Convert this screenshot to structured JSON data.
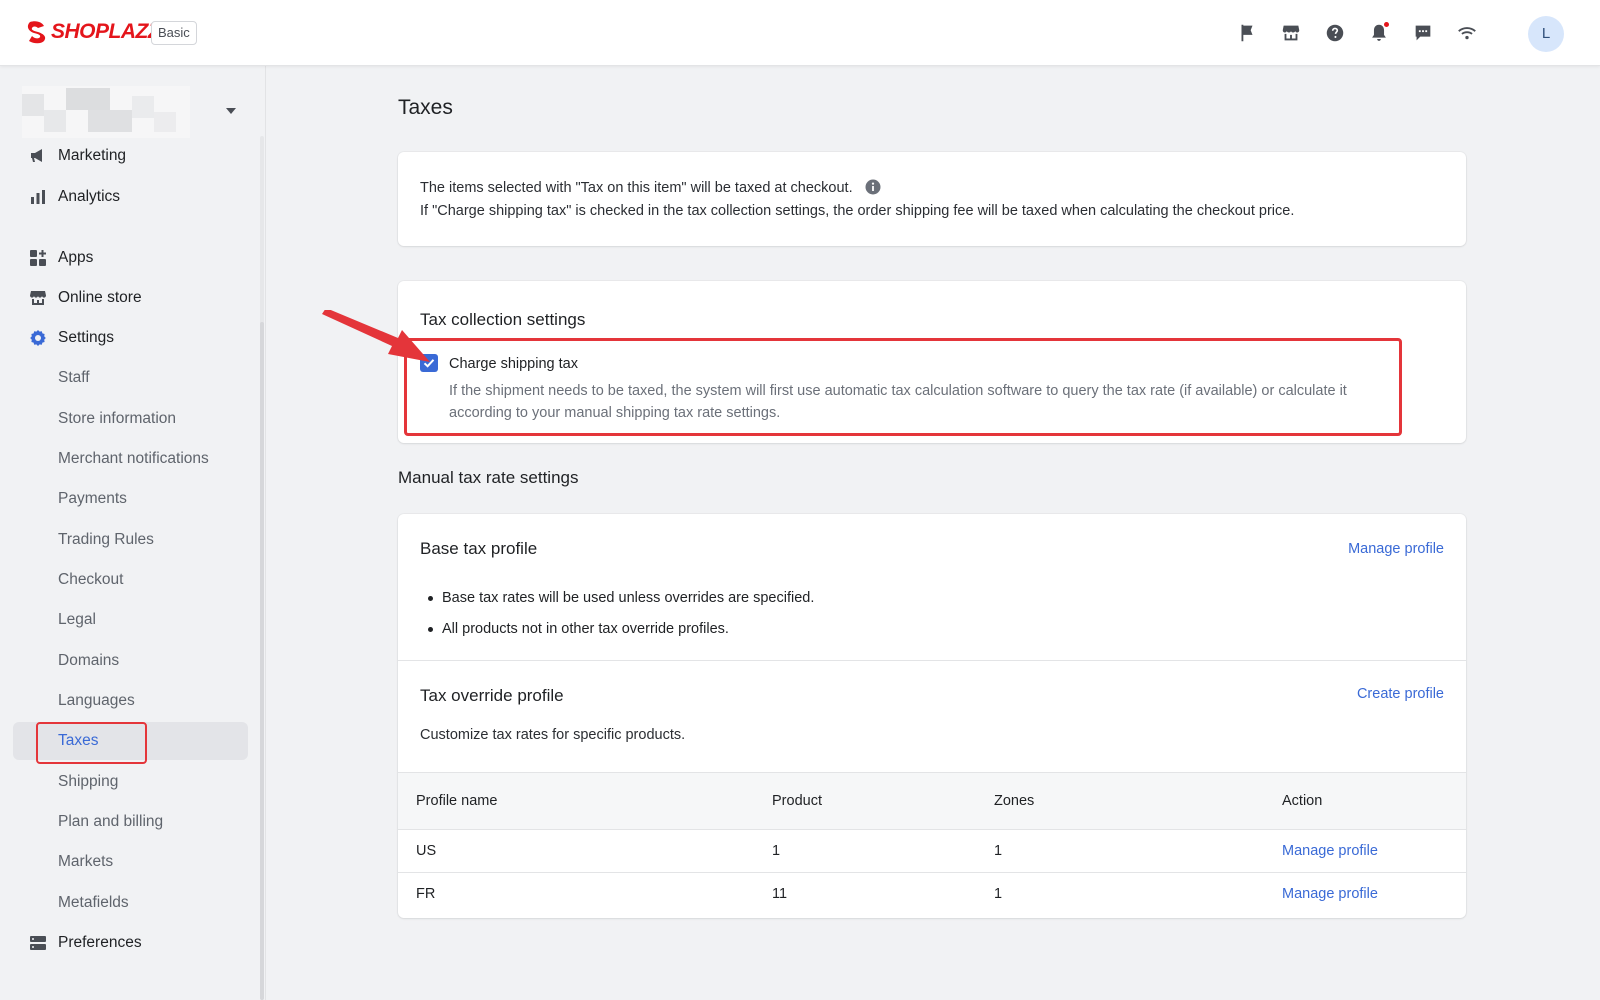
{
  "header": {
    "brand": "SHOPLAZZA",
    "plan_badge": "Basic",
    "avatar_initial": "L",
    "icons": [
      "flag-icon",
      "store-icon",
      "help-icon",
      "notification-bell-icon",
      "chat-icon",
      "wifi-icon"
    ]
  },
  "sidebar": {
    "items": [
      {
        "label": "Marketing",
        "icon": "megaphone-icon"
      },
      {
        "label": "Analytics",
        "icon": "bar-chart-icon"
      },
      {
        "label": "Apps",
        "icon": "apps-icon"
      },
      {
        "label": "Online store",
        "icon": "storefront-icon"
      },
      {
        "label": "Settings",
        "icon": "gear-icon"
      }
    ],
    "settings_children": [
      "Staff",
      "Store information",
      "Merchant notifications",
      "Payments",
      "Trading Rules",
      "Checkout",
      "Legal",
      "Domains",
      "Languages",
      "Taxes",
      "Shipping",
      "Plan and billing",
      "Markets",
      "Metafields"
    ],
    "active_item": "Taxes",
    "preferences": {
      "label": "Preferences",
      "icon": "preferences-icon"
    }
  },
  "page": {
    "title": "Taxes",
    "info": {
      "line1": "The items selected with \"Tax on this item\" will be taxed at checkout.",
      "line2": "If \"Charge shipping tax\" is checked in the tax collection settings, the order shipping fee will be taxed when calculating the checkout price."
    },
    "tax_collection": {
      "title": "Tax collection settings",
      "checkbox_label": "Charge shipping tax",
      "checkbox_checked": true,
      "help_text": "If the shipment needs to be taxed, the system will first use automatic tax calculation software to query the tax rate (if available) or calculate it according to your manual shipping tax rate settings."
    },
    "manual_section_title": "Manual tax rate settings",
    "base_profile": {
      "title": "Base tax profile",
      "link": "Manage profile",
      "bullets": [
        "Base tax rates will be used unless overrides are specified.",
        "All products not in other tax override profiles."
      ]
    },
    "override_profile": {
      "title": "Tax override profile",
      "link": "Create profile",
      "description": "Customize tax rates for specific products."
    },
    "table": {
      "headers": {
        "name": "Profile name",
        "product": "Product",
        "zones": "Zones",
        "action": "Action"
      },
      "rows": [
        {
          "name": "US",
          "product": "1",
          "zones": "1",
          "action": "Manage profile"
        },
        {
          "name": "FR",
          "product": "11",
          "zones": "1",
          "action": "Manage profile"
        }
      ]
    }
  },
  "colors": {
    "brand": "#e4151b",
    "accent": "#3a6ad6",
    "annotation": "#e4353a"
  }
}
